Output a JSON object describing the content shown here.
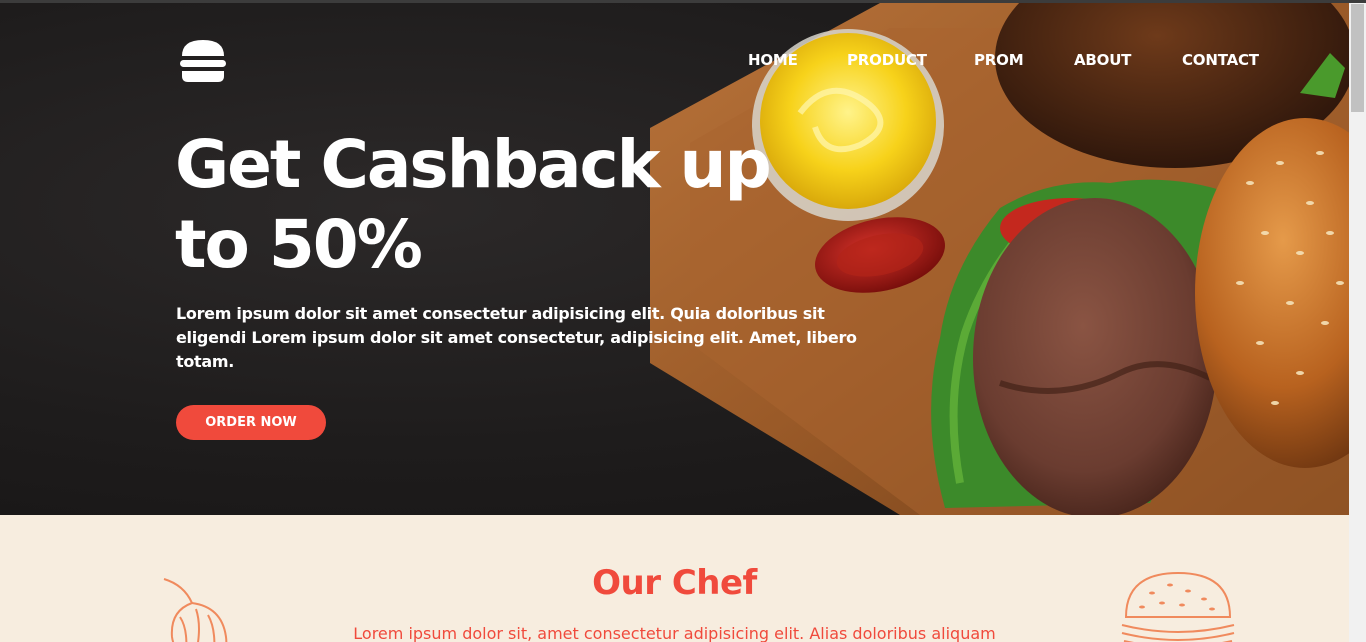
{
  "nav": {
    "items": [
      "HOME",
      "PRODUCT",
      "PROM",
      "ABOUT",
      "CONTACT"
    ]
  },
  "hero": {
    "logo_icon": "burger-icon",
    "headline_line1": "Get Cashback up",
    "headline_line2": "to 50%",
    "description": "Lorem ipsum dolor sit amet consectetur adipisicing elit. Quia doloribus sit eligendi Lorem ipsum dolor sit amet consectetur, adipisicing elit. Amet, libero totam.",
    "cta_label": "ORDER NOW"
  },
  "chef": {
    "title": "Our Chef",
    "text": "Lorem ipsum dolor sit, amet consectetur adipisicing elit. Alias doloribus aliquam"
  },
  "colors": {
    "accent": "#f04a3c",
    "hero_bg": "#1e1c1c",
    "section_bg": "#f7eddf"
  }
}
